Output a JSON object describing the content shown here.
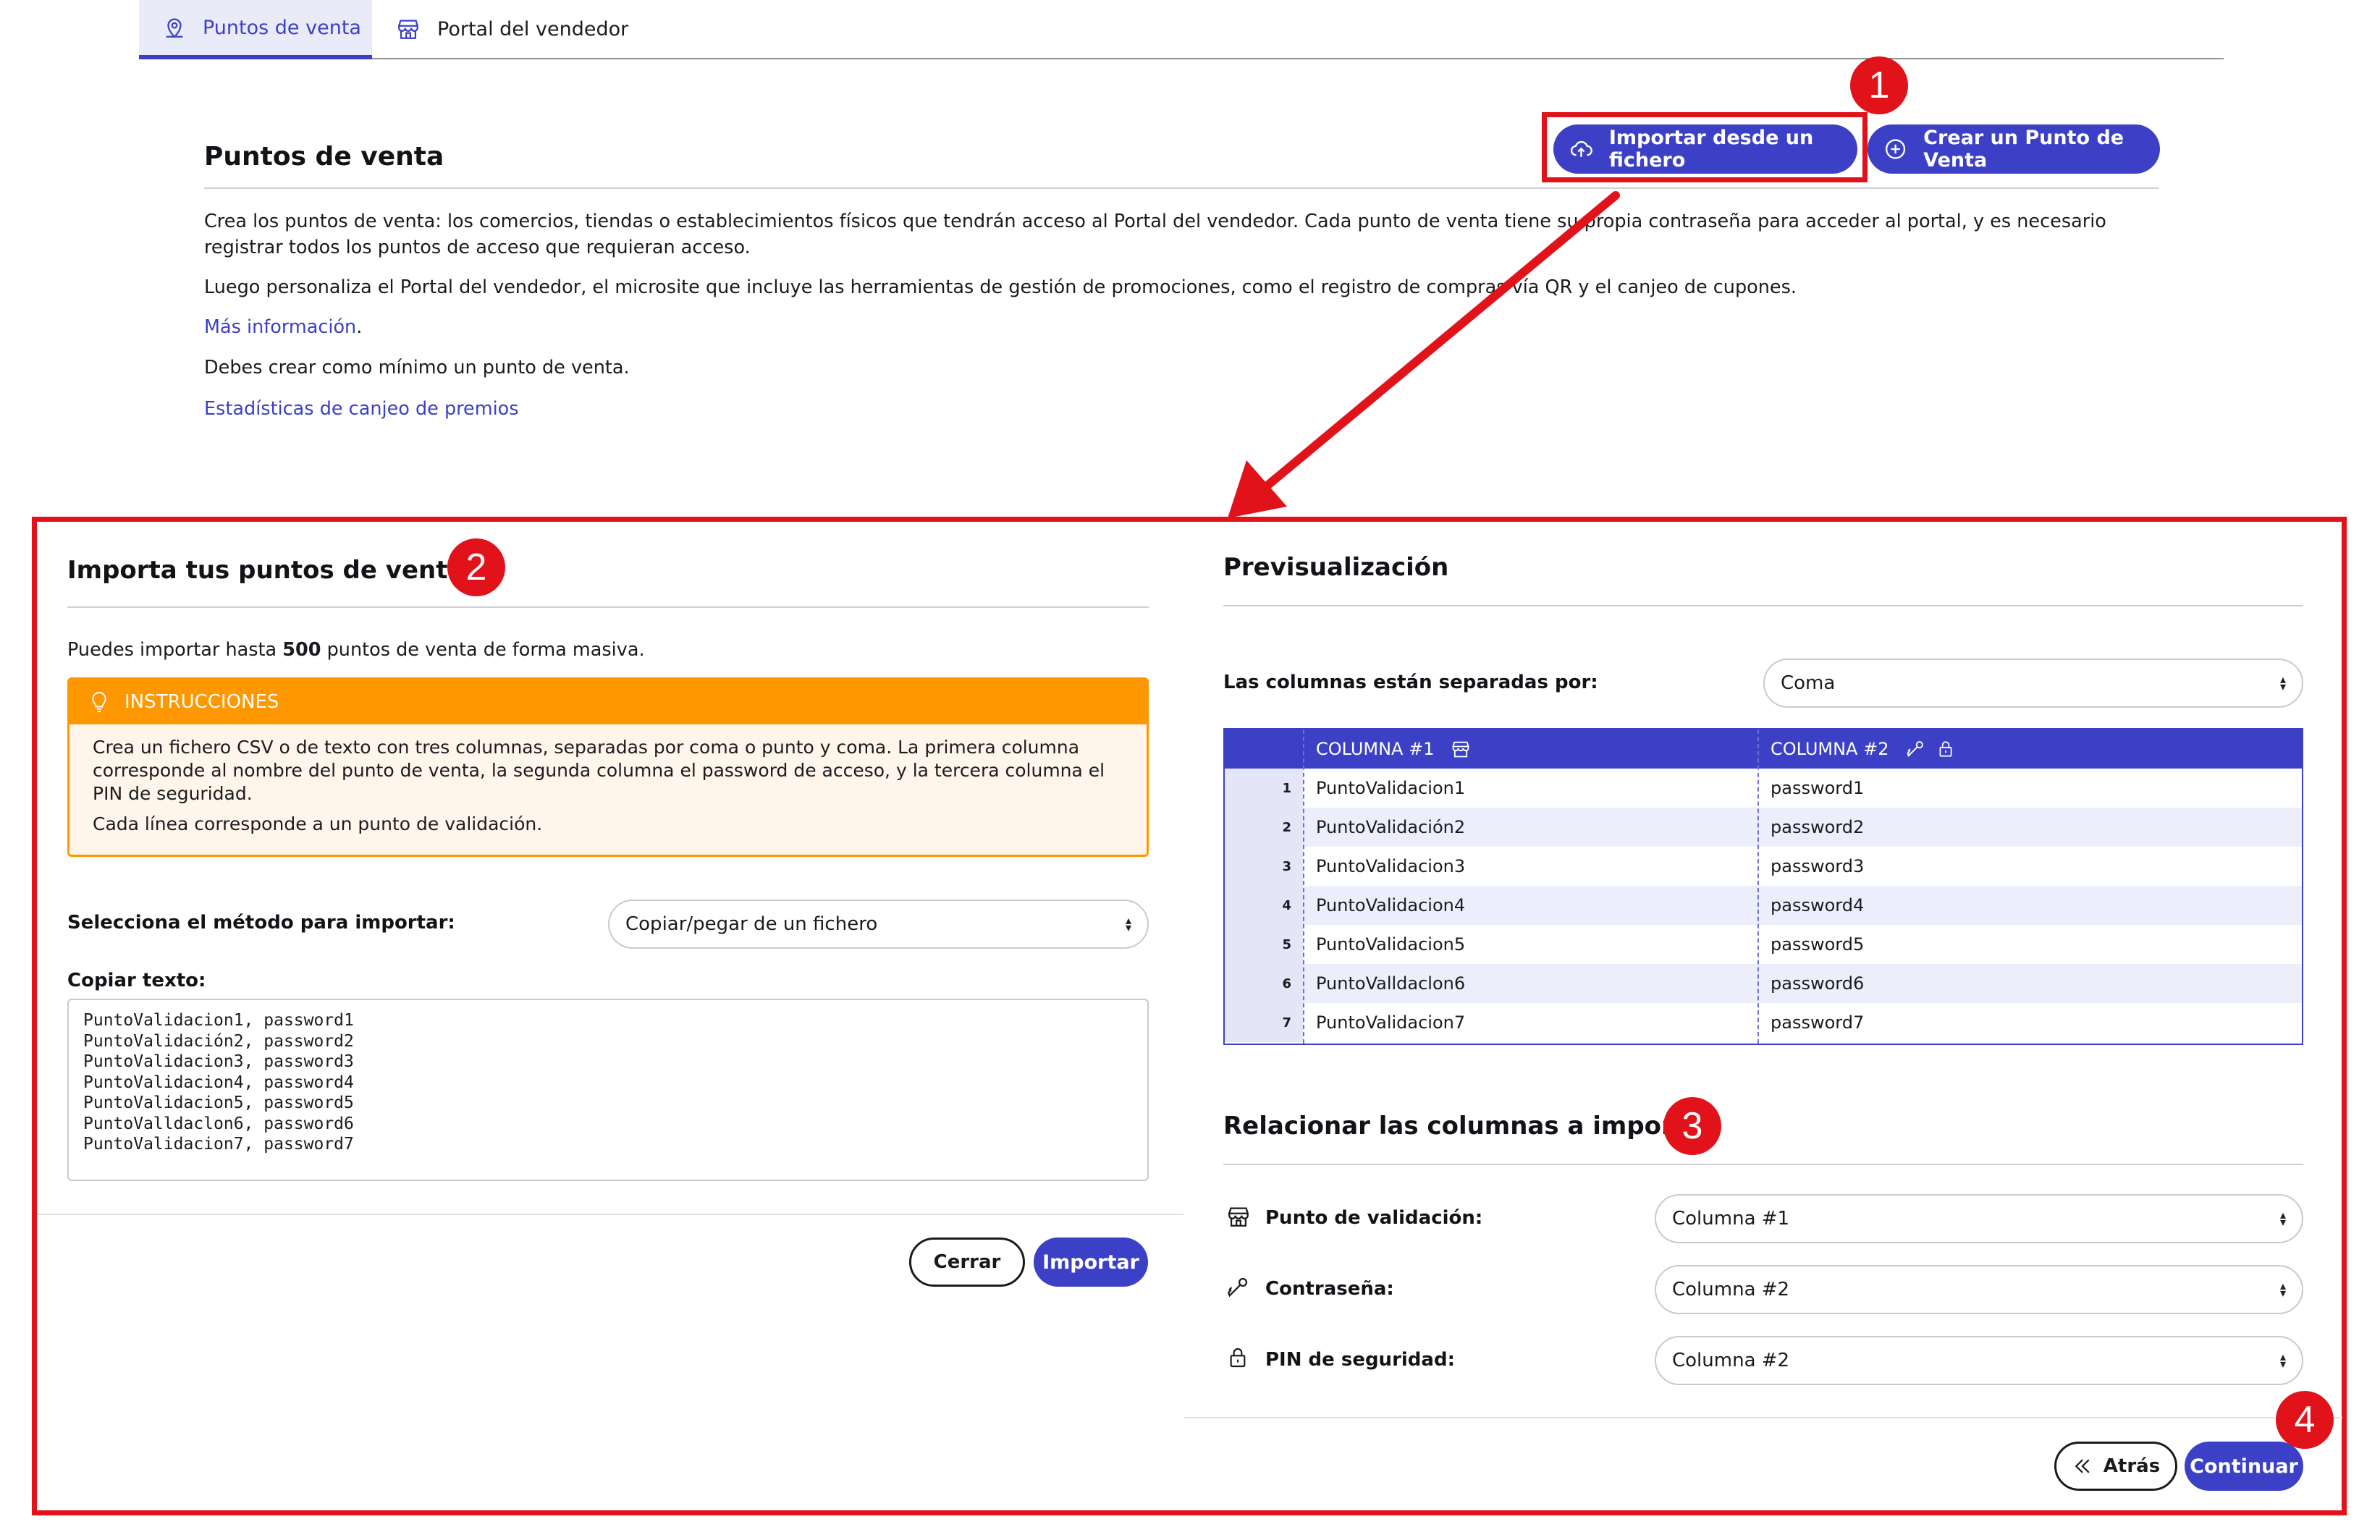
{
  "tabs": [
    {
      "label": "Puntos de venta",
      "active": true
    },
    {
      "label": "Portal del vendedor",
      "active": false
    }
  ],
  "header": {
    "title": "Puntos de venta",
    "import_button": "Importar desde un fichero",
    "create_button": "Crear un Punto de Venta"
  },
  "intro": {
    "p1": "Crea los puntos de venta: los comercios, tiendas o establecimientos físicos que tendrán acceso al Portal del vendedor. Cada punto de venta tiene su propia contraseña para acceder al portal, y es necesario registrar todos los puntos de acceso que requieran acceso.",
    "p2": "Luego personaliza el Portal del vendedor, el microsite que incluye las herramientas de gestión de promociones, como el registro de compras vía QR y el canjeo de cupones.",
    "more_info": "Más información",
    "more_info_suffix": ".",
    "p3": "Debes crear como mínimo un punto de venta.",
    "stats_link": "Estadísticas de canjeo de premios"
  },
  "annotations": {
    "b1": "1",
    "b2": "2",
    "b3": "3",
    "b4": "4",
    "color": "#e2121a"
  },
  "import_panel": {
    "title": "Importa tus puntos de venta",
    "limit_prefix": "Puedes importar hasta ",
    "limit_value": "500",
    "limit_suffix": " puntos de venta de forma masiva.",
    "instructions_title": "INSTRUCCIONES",
    "instructions_p1": "Crea un fichero CSV o de texto con tres columnas, separadas por coma o punto y coma. La primera columna corresponde al nombre del punto de venta, la segunda columna el password de acceso, y la tercera columna el PIN de seguridad.",
    "instructions_p2": "Cada línea corresponde a un punto de validación.",
    "method_label": "Selecciona el método para importar:",
    "method_value": "Copiar/pegar de un fichero",
    "copy_label": "Copiar texto:",
    "copy_text": "PuntoValidacion1, password1\nPuntoValidación2, password2\nPuntoValidacion3, password3\nPuntoValidacion4, password4\nPuntoValidacion5, password5\nPuntoValldaclon6, password6\nPuntoValidacion7, password7",
    "close_button": "Cerrar",
    "import_button": "Importar"
  },
  "preview": {
    "title": "Previsualización",
    "separator_label": "Las columnas están separadas por:",
    "separator_value": "Coma",
    "col1_header": "COLUMNA #1",
    "col2_header": "COLUMNA #2",
    "rows": [
      {
        "n": "1",
        "c1": "PuntoValidacion1",
        "c2": "password1"
      },
      {
        "n": "2",
        "c1": "PuntoValidación2",
        "c2": "password2"
      },
      {
        "n": "3",
        "c1": "PuntoValidacion3",
        "c2": "password3"
      },
      {
        "n": "4",
        "c1": "PuntoValidacion4",
        "c2": "password4"
      },
      {
        "n": "5",
        "c1": "PuntoValidacion5",
        "c2": "password5"
      },
      {
        "n": "6",
        "c1": "PuntoValldaclon6",
        "c2": "password6"
      },
      {
        "n": "7",
        "c1": "PuntoValidacion7",
        "c2": "password7"
      }
    ]
  },
  "mapping": {
    "title": "Relacionar las columnas a importar",
    "rows": [
      {
        "icon": "store-icon",
        "label": "Punto de validación:",
        "value": "Columna #1"
      },
      {
        "icon": "key-icon",
        "label": "Contraseña:",
        "value": "Columna #2"
      },
      {
        "icon": "lock-icon",
        "label": "PIN de seguridad:",
        "value": "Columna #2"
      }
    ],
    "back_button": "Atrás",
    "continue_button": "Continuar"
  },
  "colors": {
    "accent": "#3c40c6",
    "warning": "#ff9800",
    "annotation": "#e2121a"
  }
}
